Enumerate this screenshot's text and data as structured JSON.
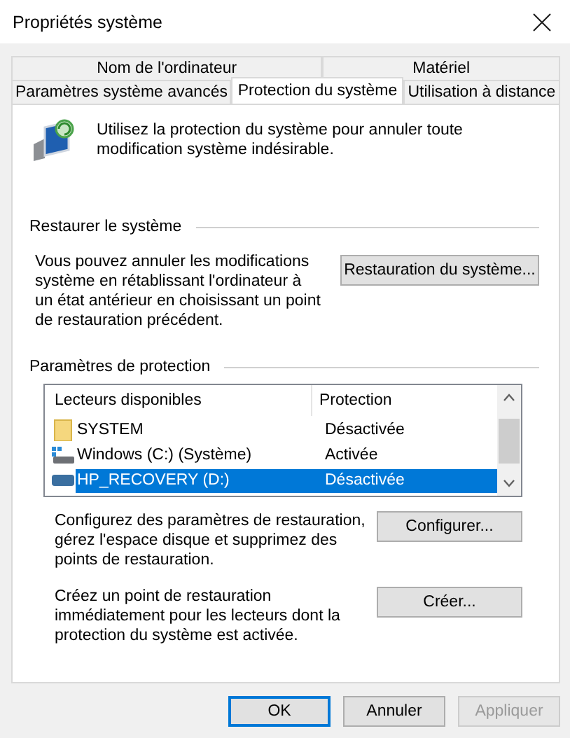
{
  "window": {
    "title": "Propriétés système"
  },
  "tab_rows": [
    [
      {
        "label": "Nom de l'ordinateur",
        "selected": false
      },
      {
        "label": "Matériel",
        "selected": false
      }
    ],
    [
      {
        "label": "Paramètres système avancés",
        "selected": false
      },
      {
        "label": "Protection du système",
        "selected": true
      },
      {
        "label": "Utilisation à distance",
        "selected": false
      }
    ]
  ],
  "intro": "Utilisez la protection du système pour annuler toute modification système indésirable.",
  "restore": {
    "title": "Restaurer le système",
    "text": "Vous pouvez annuler les modifications système en rétablissant l'ordinateur à un état antérieur en choisissant un point de restauration précédent.",
    "button": "Restauration du système..."
  },
  "protection": {
    "title": "Paramètres de protection",
    "columns": [
      "Lecteurs disponibles",
      "Protection"
    ],
    "rows": [
      {
        "kind": "folder",
        "name": "SYSTEM",
        "protection": "Désactivée",
        "selected": false
      },
      {
        "kind": "system-drive",
        "name": "Windows (C:) (Système)",
        "protection": "Activée",
        "selected": false
      },
      {
        "kind": "drive",
        "name": "HP_RECOVERY (D:)",
        "protection": "Désactivée",
        "selected": true
      }
    ],
    "actions": [
      {
        "text": "Configurez des paramètres de restauration, gérez l'espace disque et supprimez des points de restauration.",
        "button": "Configurer..."
      },
      {
        "text": "Créez un point de restauration immédiatement pour les lecteurs dont la protection du système est activée.",
        "button": "Créer..."
      }
    ]
  },
  "buttons": [
    {
      "label": "OK",
      "default": true,
      "disabled": false
    },
    {
      "label": "Annuler",
      "default": false,
      "disabled": false
    },
    {
      "label": "Appliquer",
      "default": false,
      "disabled": true
    }
  ]
}
